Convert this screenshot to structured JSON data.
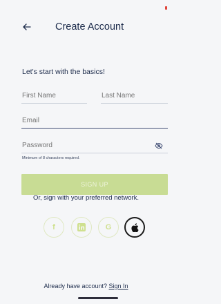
{
  "header": {
    "back_icon": "arrow-left-icon",
    "title": "Create Account"
  },
  "intro": "Let's start with the basics!",
  "form": {
    "first_name_placeholder": "First Name",
    "last_name_placeholder": "Last Name",
    "email_placeholder": "Email",
    "password_placeholder": "Password",
    "password_hint": "Minimum of 8 characters required.",
    "toggle_icon": "eye-slash-icon",
    "submit_label": "SIGN UP"
  },
  "social": {
    "label": "Or, sign with your preferred network.",
    "networks": [
      {
        "name": "facebook",
        "glyph": "f"
      },
      {
        "name": "linkedin",
        "glyph": "in"
      },
      {
        "name": "google",
        "glyph": "G"
      },
      {
        "name": "apple",
        "glyph": ""
      }
    ]
  },
  "footer": {
    "prompt": "Already have account?",
    "link": "Sign In"
  },
  "colors": {
    "accent": "#c8dc94",
    "text": "#1b2a4a",
    "background": "#f5f6f8"
  }
}
